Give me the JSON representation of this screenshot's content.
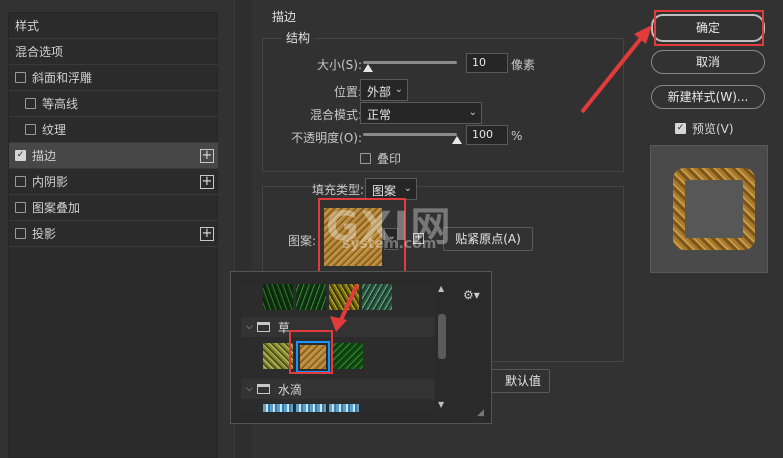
{
  "left_panel": {
    "items": [
      {
        "label": "样式",
        "checkbox": "none",
        "checked": false,
        "plus": false,
        "indent": "none",
        "selected": false
      },
      {
        "label": "混合选项",
        "checkbox": "none",
        "checked": false,
        "plus": false,
        "indent": "none",
        "selected": false
      },
      {
        "label": "斜面和浮雕",
        "checkbox": "show",
        "checked": false,
        "plus": false,
        "indent": "none",
        "selected": false
      },
      {
        "label": "等高线",
        "checkbox": "show",
        "checked": false,
        "plus": false,
        "indent": "sub",
        "selected": false
      },
      {
        "label": "纹理",
        "checkbox": "show",
        "checked": false,
        "plus": false,
        "indent": "sub",
        "selected": false
      },
      {
        "label": "描边",
        "checkbox": "show",
        "checked": true,
        "plus": true,
        "indent": "none",
        "selected": true
      },
      {
        "label": "内阴影",
        "checkbox": "show",
        "checked": false,
        "plus": true,
        "indent": "none",
        "selected": false
      },
      {
        "label": "图案叠加",
        "checkbox": "show",
        "checked": false,
        "plus": false,
        "indent": "none",
        "selected": false
      },
      {
        "label": "投影",
        "checkbox": "show",
        "checked": false,
        "plus": true,
        "indent": "none",
        "selected": false
      }
    ]
  },
  "stroke": {
    "title": "描边",
    "structure_title": "结构",
    "size_label": "大小(S):",
    "size_value": "10",
    "size_unit": "像素",
    "size_slider": 0.05,
    "position_label": "位置:",
    "position_value": "外部",
    "blend_label": "混合模式:",
    "blend_value": "正常",
    "opacity_label": "不透明度(O):",
    "opacity_value": "100",
    "opacity_unit": "%",
    "opacity_slider": 1.0,
    "overprint_label": "叠印",
    "fill_type_label": "填充类型:",
    "fill_type_value": "图案",
    "pattern_label": "图案:",
    "snap_origin_label": "贴紧原点(A)",
    "default_label": "默认值"
  },
  "buttons": {
    "ok": "确定",
    "cancel": "取消",
    "new_style": "新建样式(W)...",
    "preview_label": "预览(V)",
    "preview_checked": true
  },
  "pattern_picker": {
    "folders": [
      {
        "name": "草"
      },
      {
        "name": "水滴"
      }
    ],
    "gear_icon": "gear-icon"
  },
  "watermark": {
    "main": "GXI网",
    "sub": "system.com"
  },
  "colors": {
    "annotation_red": "#e23b3b",
    "selection_blue": "#1e90ff"
  }
}
